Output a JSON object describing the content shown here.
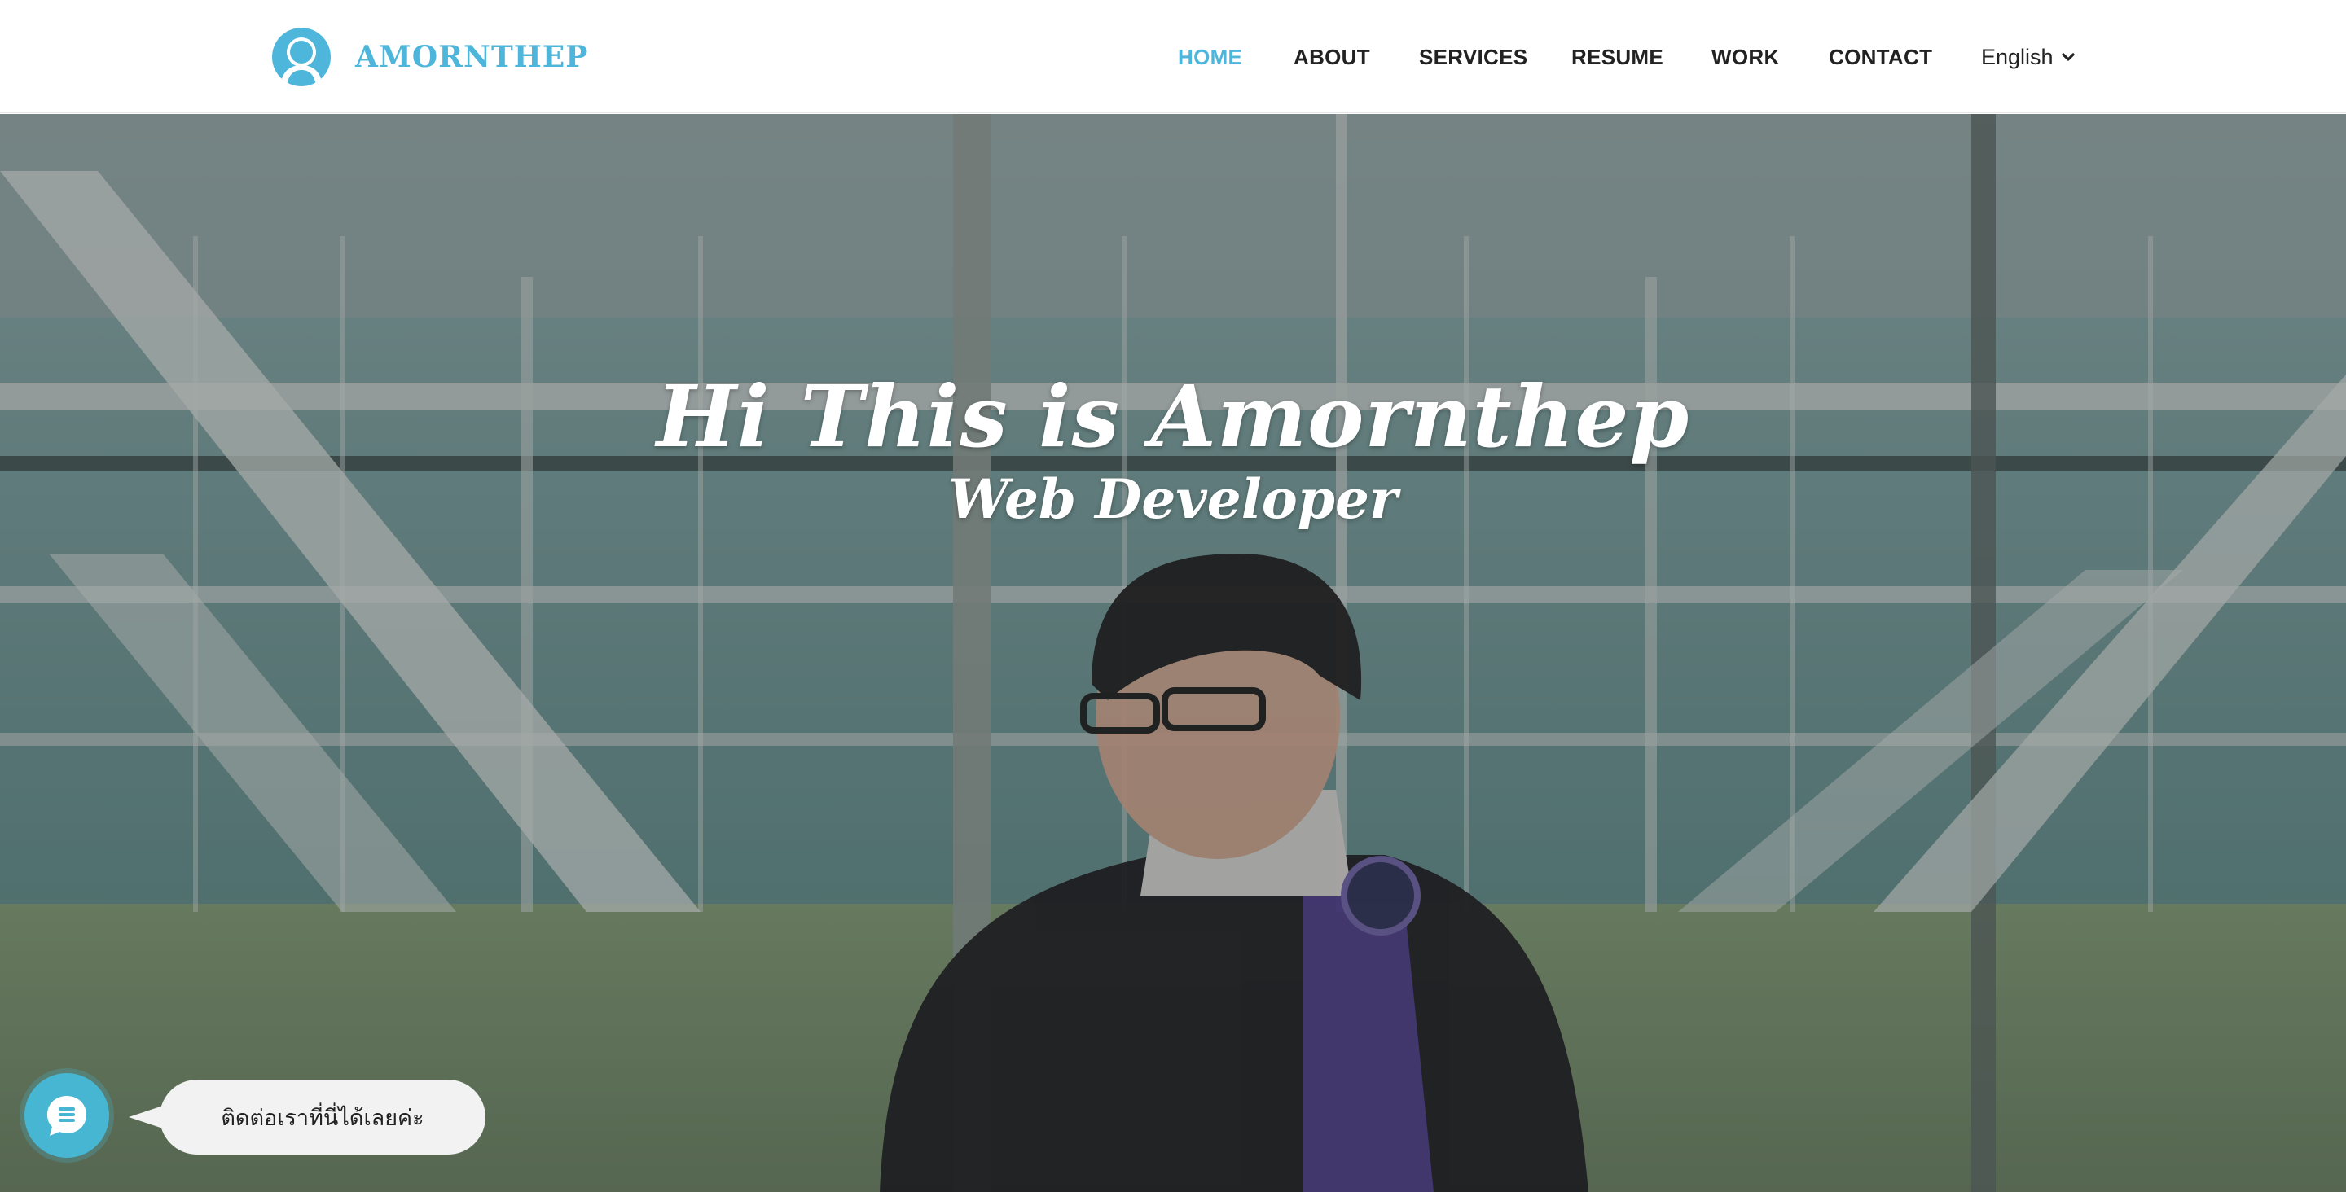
{
  "brand": {
    "name": "AMORNTHEP",
    "avatar_icon": "user-avatar-icon"
  },
  "nav": {
    "items": [
      {
        "label": "HOME",
        "active": true
      },
      {
        "label": "ABOUT",
        "active": false
      },
      {
        "label": "SERVICES",
        "active": false
      },
      {
        "label": "RESUME",
        "active": false
      },
      {
        "label": "WORK",
        "active": false
      },
      {
        "label": "CONTACT",
        "active": false
      }
    ],
    "language": {
      "label": "English",
      "icon": "chevron-down-icon"
    }
  },
  "hero": {
    "title": "Hi This is Amornthep",
    "subtitle": "Web Developer"
  },
  "chat": {
    "icon": "chat-icon",
    "bubble_text": "ติดต่อเราที่นี่ได้เลยค่ะ"
  },
  "colors": {
    "accent": "#4fb6db",
    "chat": "#46b6d3",
    "text": "#222222"
  }
}
